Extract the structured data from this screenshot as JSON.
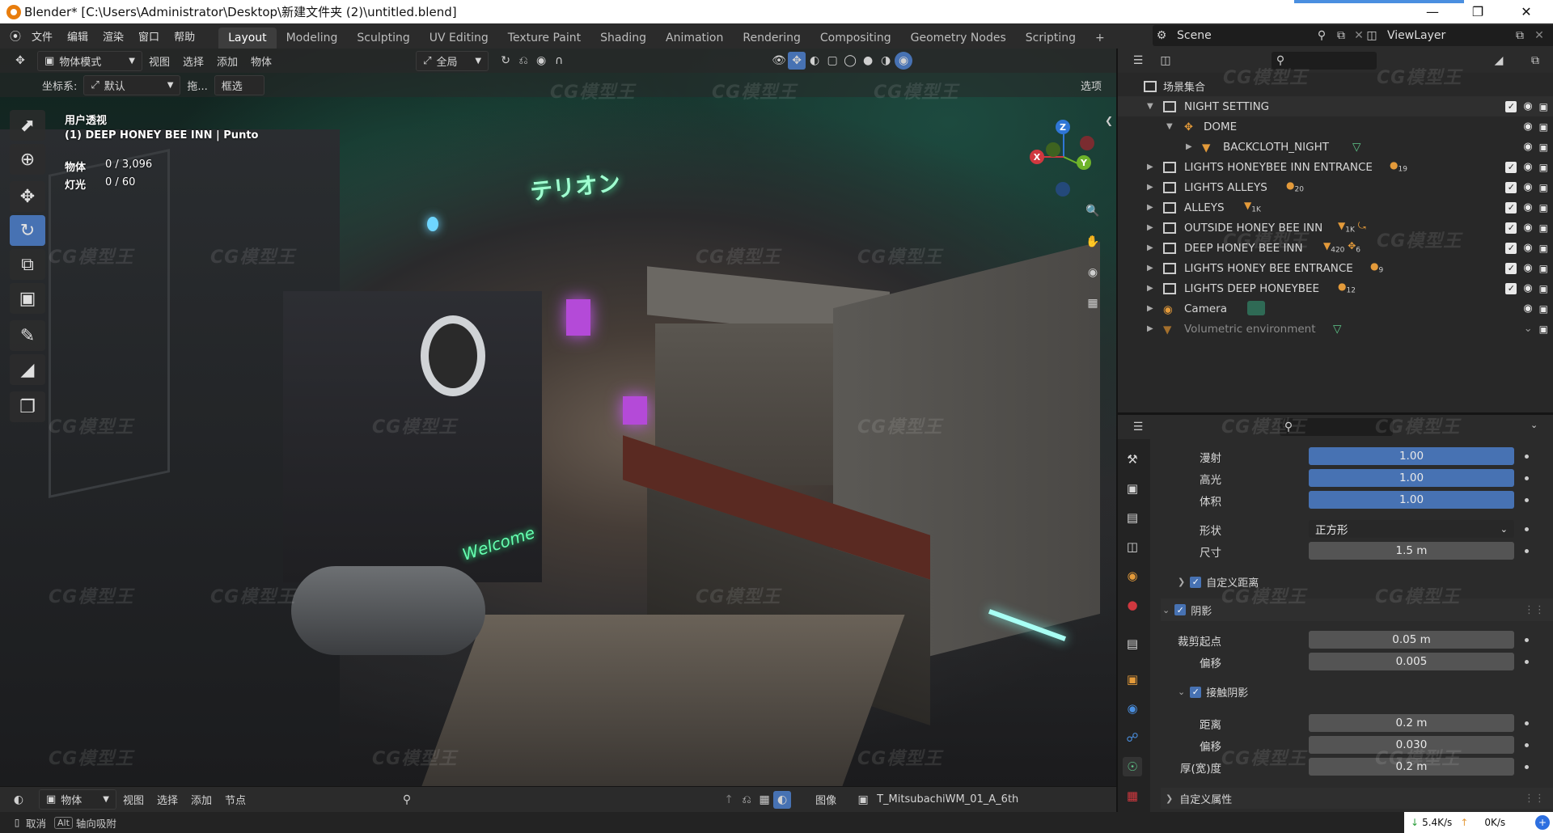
{
  "window": {
    "title": "Blender* [C:\\Users\\Administrator\\Desktop\\新建文件夹 (2)\\untitled.blend]"
  },
  "menu": [
    "文件",
    "编辑",
    "渲染",
    "窗口",
    "帮助"
  ],
  "workspaces": [
    "Layout",
    "Modeling",
    "Sculpting",
    "UV Editing",
    "Texture Paint",
    "Shading",
    "Animation",
    "Rendering",
    "Compositing",
    "Geometry Nodes",
    "Scripting"
  ],
  "active_workspace": "Layout",
  "scene": "Scene",
  "view_layer": "ViewLayer",
  "viewport_header": {
    "mode": "物体模式",
    "menus": [
      "视图",
      "选择",
      "添加",
      "物体"
    ],
    "transform": "全局"
  },
  "viewport_subheader": {
    "coord_label": "坐标系:",
    "coord_value": "默认",
    "drag_label": "拖...",
    "select_box": "框选",
    "options": "选项"
  },
  "viewport_overlay": {
    "view_name": "用户透视",
    "collection": "(1) DEEP HONEY BEE INN | Punto",
    "objects_label": "物体",
    "objects_value": "0 / 3,096",
    "lights_label": "灯光",
    "lights_value": "0 / 60"
  },
  "scene_signs": {
    "katakana": "テリオン",
    "welcome": "Welcome"
  },
  "gizmo": {
    "x": "X",
    "y": "Y",
    "z": "Z"
  },
  "outliner": {
    "root": "场景集合",
    "rows": [
      {
        "label": "NIGHT SETTING",
        "badge": ""
      },
      {
        "label": "DOME",
        "badge": ""
      },
      {
        "label": "BACKCLOTH_NIGHT",
        "badge": ""
      },
      {
        "label": "LIGHTS HONEYBEE INN ENTRANCE",
        "badge": "19"
      },
      {
        "label": "LIGHTS ALLEYS",
        "badge": "20"
      },
      {
        "label": "ALLEYS",
        "badge": "1K"
      },
      {
        "label": "OUTSIDE HONEY BEE INN",
        "badge": "1K"
      },
      {
        "label": "DEEP HONEY BEE INN",
        "badge": "420",
        "badge2": "6"
      },
      {
        "label": "LIGHTS HONEY BEE ENTRANCE",
        "badge": "9"
      },
      {
        "label": "LIGHTS DEEP HONEYBEE",
        "badge": "12"
      },
      {
        "label": "Camera",
        "badge": ""
      },
      {
        "label": "Volumetric environment",
        "badge": ""
      }
    ]
  },
  "properties": {
    "diffuse_label": "漫射",
    "diffuse_value": "1.00",
    "specular_label": "高光",
    "specular_value": "1.00",
    "volume_label": "体积",
    "volume_value": "1.00",
    "shape_label": "形状",
    "shape_value": "正方形",
    "size_label": "尺寸",
    "size_value": "1.5 m",
    "custom_distance": "自定义距离",
    "shadow": "阴影",
    "clip_start_label": "裁剪起点",
    "clip_start_value": "0.05 m",
    "bias_label": "偏移",
    "bias_value": "0.005",
    "contact_shadow": "接触阴影",
    "distance_label": "距离",
    "distance_value": "0.2 m",
    "cs_bias_label": "偏移",
    "cs_bias_value": "0.030",
    "thickness_label": "厚(宽)度",
    "thickness_value": "0.2 m",
    "custom_props": "自定义属性"
  },
  "bottom_editor": {
    "mode": "物体",
    "menus": [
      "视图",
      "选择",
      "添加",
      "节点"
    ],
    "image_label": "图像",
    "image_name": "T_MitsubachiWM_01_A_6th"
  },
  "statusbar": {
    "cancel": "取消",
    "alt_key": "Alt",
    "axis_snap": "轴向吸附",
    "down_speed": "5.4K/s",
    "up_speed": "0K/s"
  },
  "watermark": "CG模型王",
  "colors": {
    "accent": "#4772b3",
    "panel": "#2b2b2b",
    "outliner": "#282828"
  }
}
